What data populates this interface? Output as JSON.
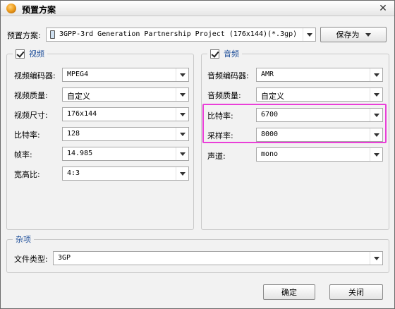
{
  "window": {
    "title": "预置方案"
  },
  "preset": {
    "label": "预置方案:",
    "value": "3GPP-3rd Generation Partnership Project (176x144)(*.3gp)",
    "save_as": "保存为"
  },
  "video": {
    "legend": "视频",
    "enabled": true,
    "fields": [
      {
        "label": "视频编码器:",
        "value": "MPEG4"
      },
      {
        "label": "视频质量:",
        "value": "自定义"
      },
      {
        "label": "视频尺寸:",
        "value": "176x144"
      },
      {
        "label": "比特率:",
        "value": "128"
      },
      {
        "label": "帧率:",
        "value": "14.985"
      },
      {
        "label": "宽高比:",
        "value": "4:3"
      }
    ]
  },
  "audio": {
    "legend": "音频",
    "enabled": true,
    "fields": [
      {
        "label": "音频编码器:",
        "value": "AMR"
      },
      {
        "label": "音频质量:",
        "value": "自定义"
      },
      {
        "label": "比特率:",
        "value": "6700"
      },
      {
        "label": "采样率:",
        "value": "8000"
      },
      {
        "label": "声道:",
        "value": "mono"
      }
    ]
  },
  "misc": {
    "legend": "杂项",
    "file_type_label": "文件类型:",
    "file_type_value": "3GP"
  },
  "buttons": {
    "ok": "确定",
    "close": "关闭"
  },
  "colors": {
    "highlight": "#ea3fd8",
    "legend_text": "#1f4f9a"
  }
}
